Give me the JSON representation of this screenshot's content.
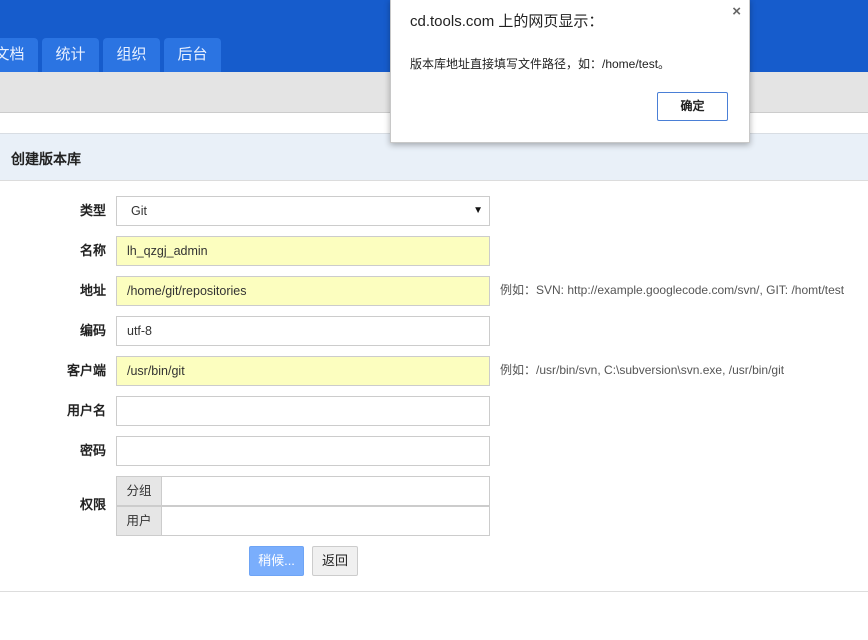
{
  "nav": {
    "tabs": [
      "文档",
      "统计",
      "组织",
      "后台"
    ]
  },
  "section": {
    "title": "创建版本库"
  },
  "form": {
    "type": {
      "label": "类型",
      "value": "Git"
    },
    "name": {
      "label": "名称",
      "value": "lh_qzgj_admin"
    },
    "path": {
      "label": "地址",
      "value": "/home/git/repositories",
      "help": "例如：SVN: http://example.googlecode.com/svn/, GIT: /homt/test"
    },
    "encoding": {
      "label": "编码",
      "value": "utf-8"
    },
    "client": {
      "label": "客户端",
      "value": "/usr/bin/git",
      "help": "例如：/usr/bin/svn, C:\\subversion\\svn.exe, /usr/bin/git"
    },
    "username": {
      "label": "用户名",
      "value": ""
    },
    "password": {
      "label": "密码",
      "value": ""
    },
    "acl": {
      "label": "权限",
      "group_label": "分组",
      "user_label": "用户"
    },
    "submit_label": "稍候...",
    "back_label": "返回"
  },
  "dialog": {
    "title": "cd.tools.com 上的网页显示：",
    "message": "版本库地址直接填写文件路径，如：/home/test。",
    "ok_label": "确定",
    "close": "×"
  }
}
